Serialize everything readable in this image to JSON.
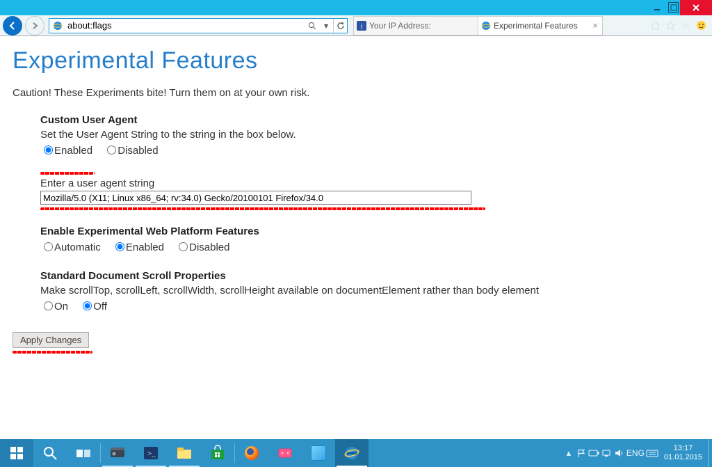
{
  "window": {
    "minimize": "—",
    "maximize": "❐",
    "close": "×"
  },
  "nav": {
    "url": "about:flags"
  },
  "tabs": [
    {
      "label": "Your IP Address:",
      "active": false
    },
    {
      "label": "Experimental Features",
      "active": true
    }
  ],
  "page": {
    "heading": "Experimental Features",
    "caution": "Caution! These Experiments bite! Turn them on at your own risk.",
    "ua": {
      "title": "Custom User Agent",
      "desc": "Set the User Agent String to the string in the box below.",
      "enabled": "Enabled",
      "disabled": "Disabled",
      "prompt": "Enter a user agent string",
      "value": "Mozilla/5.0 (X11; Linux x86_64; rv:34.0) Gecko/20100101 Firefox/34.0"
    },
    "webplat": {
      "title": "Enable Experimental Web Platform Features",
      "auto": "Automatic",
      "enabled": "Enabled",
      "disabled": "Disabled"
    },
    "scroll": {
      "title": "Standard Document Scroll Properties",
      "desc": "Make scrollTop, scrollLeft, scrollWidth, scrollHeight available on documentElement rather than body element",
      "on": "On",
      "off": "Off"
    },
    "apply": "Apply Changes"
  },
  "tray": {
    "lang": "ENG",
    "time": "13:17",
    "date": "01.01.2015"
  }
}
